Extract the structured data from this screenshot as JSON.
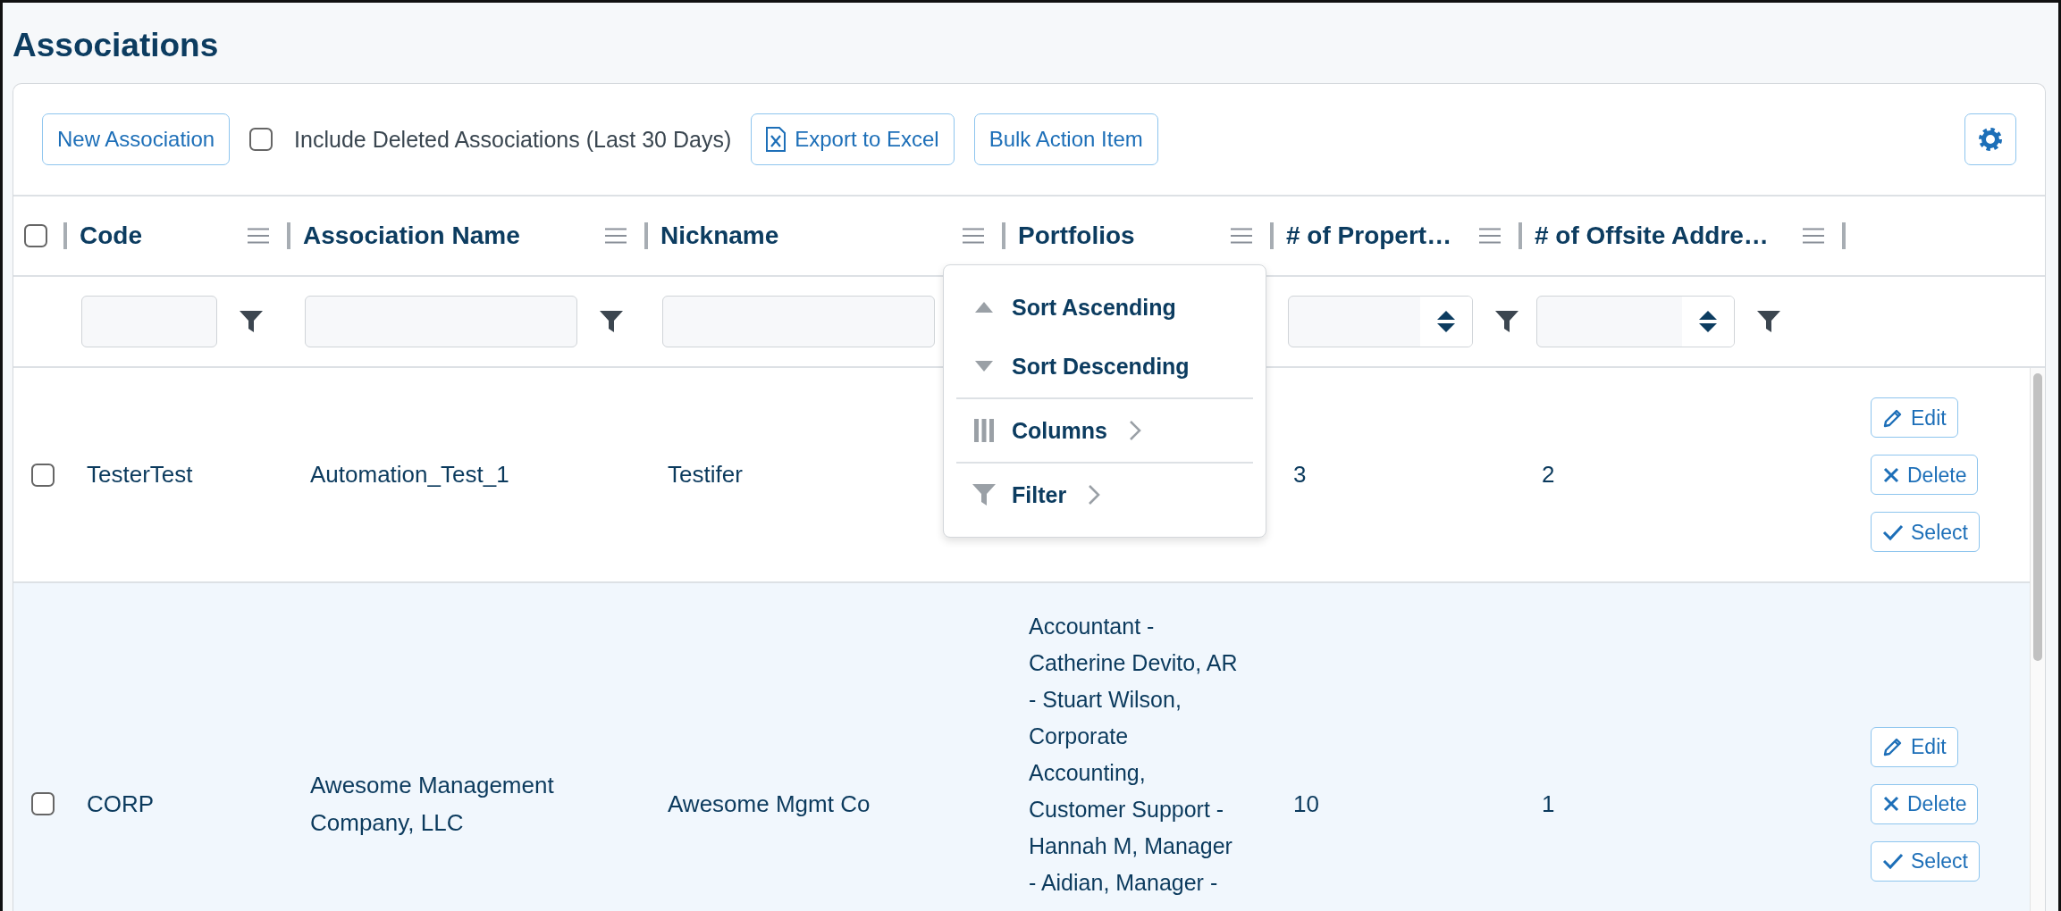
{
  "page": {
    "title": "Associations"
  },
  "toolbar": [
    {
      "kind": "button",
      "label": "New Association"
    },
    {
      "kind": "checkbox",
      "label": "Include Deleted Associations (Last 30 Days)",
      "checked": false
    },
    {
      "kind": "export",
      "label": "Export to Excel"
    },
    {
      "kind": "button",
      "label": "Bulk Action Item"
    },
    {
      "kind": "settings"
    }
  ],
  "table": {
    "select_all": {
      "checked": false
    },
    "columns": [
      {
        "label": "Code",
        "filter": {
          "kind": "text"
        }
      },
      {
        "label": "Association Name",
        "filter": {
          "kind": "text"
        }
      },
      {
        "label": "Nickname",
        "filter": {
          "kind": "text"
        }
      },
      {
        "label": "Portfolios"
      },
      {
        "label": "# of Propert…",
        "filter": {
          "kind": "number"
        }
      },
      {
        "label": "# of Offsite Addre…",
        "filter": {
          "kind": "number"
        }
      }
    ],
    "rows": [
      {
        "checked": false,
        "highlighted": false,
        "code": "TesterTest",
        "name": "Automation_Test_1",
        "nickname": "Testifer",
        "properties": "3",
        "offsite": "2",
        "actions": [
          {
            "kind": "edit",
            "label": "Edit"
          },
          {
            "kind": "delete",
            "label": "Delete"
          },
          {
            "kind": "select",
            "label": "Select"
          }
        ]
      },
      {
        "checked": false,
        "highlighted": true,
        "code": "CORP",
        "name": "Awesome Management Company, LLC",
        "nickname": "Awesome Mgmt Co",
        "portfolios": [
          "Accountant -",
          "Catherine Devito, AR",
          "- Stuart Wilson,",
          "Corporate",
          "Accounting,",
          "Customer Support -",
          "Hannah M, Manager",
          "- Aidian, Manager -"
        ],
        "properties": "10",
        "offsite": "1",
        "actions": [
          {
            "kind": "edit",
            "label": "Edit"
          },
          {
            "kind": "delete",
            "label": "Delete"
          },
          {
            "kind": "select",
            "label": "Select"
          }
        ]
      }
    ]
  },
  "column_menu": {
    "groups": [
      [
        {
          "kind": "sort-asc",
          "label": "Sort Ascending",
          "submenu": false
        },
        {
          "kind": "sort-desc",
          "label": "Sort Descending",
          "submenu": false
        }
      ],
      [
        {
          "kind": "columns",
          "label": "Columns",
          "submenu": true
        }
      ],
      [
        {
          "kind": "filter",
          "label": "Filter",
          "submenu": true
        }
      ]
    ]
  }
}
